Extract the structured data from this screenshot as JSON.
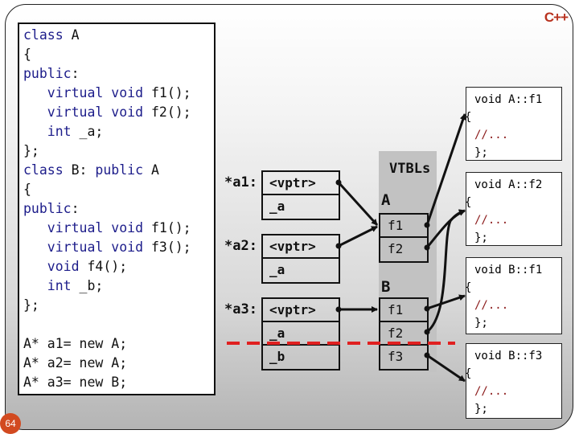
{
  "logo": "C++",
  "page_number": "64",
  "code": {
    "lines": [
      {
        "kw": "class",
        "rest": " A"
      },
      {
        "kw": "",
        "rest": "{"
      },
      {
        "kw": "public",
        "rest": ":"
      },
      {
        "kw": "   virtual void",
        "rest": " f1();"
      },
      {
        "kw": "   virtual void",
        "rest": " f2();"
      },
      {
        "kw": "   int",
        "rest": " _a;"
      },
      {
        "kw": "",
        "rest": "};"
      },
      {
        "kw": "class",
        "rest": " B: "
      },
      {
        "kw": "",
        "rest": "{"
      },
      {
        "kw": "public",
        "rest": ":"
      },
      {
        "kw": "   virtual void",
        "rest": " f1();"
      },
      {
        "kw": "   virtual void",
        "rest": " f3();"
      },
      {
        "kw": "   void",
        "rest": " f4();"
      },
      {
        "kw": "   int",
        "rest": " _b;"
      },
      {
        "kw": "",
        "rest": "};"
      },
      {
        "kw": "",
        "rest": ""
      },
      {
        "kw": "",
        "rest": "A* a1= new A;"
      },
      {
        "kw": "",
        "rest": "A* a2= new A;"
      },
      {
        "kw": "",
        "rest": "A* a3= new B;"
      }
    ],
    "line8_kw2": "public",
    "line8_tail": " A"
  },
  "objects": [
    {
      "label": "*a1:",
      "cells": [
        "<vptr>",
        "_a"
      ]
    },
    {
      "label": "*a2:",
      "cells": [
        "<vptr>",
        "_a"
      ]
    },
    {
      "label": "*a3:",
      "cells": [
        "<vptr>",
        "_a",
        "_b"
      ]
    }
  ],
  "vtbls": {
    "title": "VTBLs",
    "tables": [
      {
        "name": "A",
        "entries": [
          "f1",
          "f2"
        ]
      },
      {
        "name": "B",
        "entries": [
          "f1",
          "f2",
          "f3"
        ]
      }
    ]
  },
  "functions": [
    {
      "signature": "void A::f1",
      "open": "{",
      "body": "//...",
      "close": "};"
    },
    {
      "signature": "void A::f2",
      "open": "{",
      "body": "//...",
      "close": "};"
    },
    {
      "signature": "void B::f1",
      "open": "{",
      "body": "//...",
      "close": "};"
    },
    {
      "signature": "void B::f3",
      "open": "{",
      "body": "//...",
      "close": "};"
    }
  ],
  "colors": {
    "keyword": "#1c1c8a",
    "comment": "#8b1a1a",
    "divider": "#e02020",
    "logo": "#b8321f",
    "badge": "#d24a20"
  }
}
